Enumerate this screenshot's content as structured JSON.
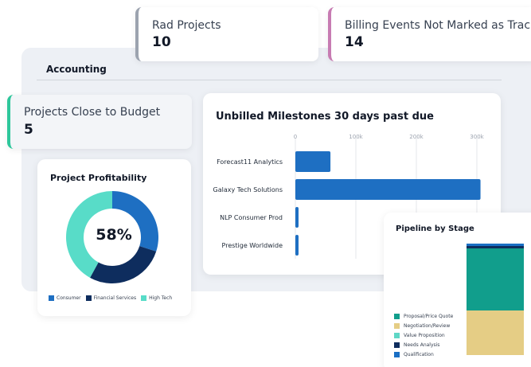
{
  "kpis": {
    "rad_projects": {
      "label": "Rad Projects",
      "value": "10"
    },
    "billing_events": {
      "label": "Billing Events Not Marked as Tracked",
      "value": "14"
    },
    "close_budget": {
      "label": "Projects Close to Budget",
      "value": "5"
    }
  },
  "section": {
    "title": "Accounting"
  },
  "colors": {
    "blue": "#1e6fc2",
    "navy": "#0e2d5e",
    "teal": "#58dcc8",
    "pipeline_teal": "#119e8c",
    "pipeline_tan": "#e5cd85",
    "pipeline_light_teal": "#5fd7c6",
    "pipeline_blue": "#1a6fc4"
  },
  "chart_data": [
    {
      "type": "bar",
      "orientation": "horizontal",
      "title": "Unbilled Milestones 30 days past due",
      "categories": [
        "Forecast11 Analytics",
        "Galaxy Tech Solutions",
        "NLP Consumer Prod",
        "Prestige Worldwide"
      ],
      "values": [
        58000,
        306000,
        5000,
        5000
      ],
      "xlim": [
        0,
        300000
      ],
      "x_ticks": [
        0,
        100000,
        200000,
        300000
      ],
      "x_tick_labels": [
        "0",
        "100k",
        "200k",
        "300k"
      ],
      "grid": true
    },
    {
      "type": "pie",
      "title": "Project Profitability",
      "center_label": "58%",
      "labels": [
        "Consumer",
        "Financial Services",
        "High Tech"
      ],
      "values": [
        30,
        28,
        42
      ],
      "legend": "bottom"
    },
    {
      "type": "bar",
      "stacked": true,
      "title": "Pipeline by Stage",
      "legend_labels": [
        "Proposal/Price Quote",
        "Negotiation/Review",
        "Value Proposition",
        "Needs Analysis",
        "Qualification"
      ],
      "stack_values": [
        {
          "label": "Qualification",
          "value": 2
        },
        {
          "label": "Needs Analysis",
          "value": 2
        },
        {
          "label": "Proposal/Price Quote",
          "value": 56
        },
        {
          "label": "Negotiation/Review",
          "value": 40
        }
      ],
      "legend": "left"
    }
  ]
}
